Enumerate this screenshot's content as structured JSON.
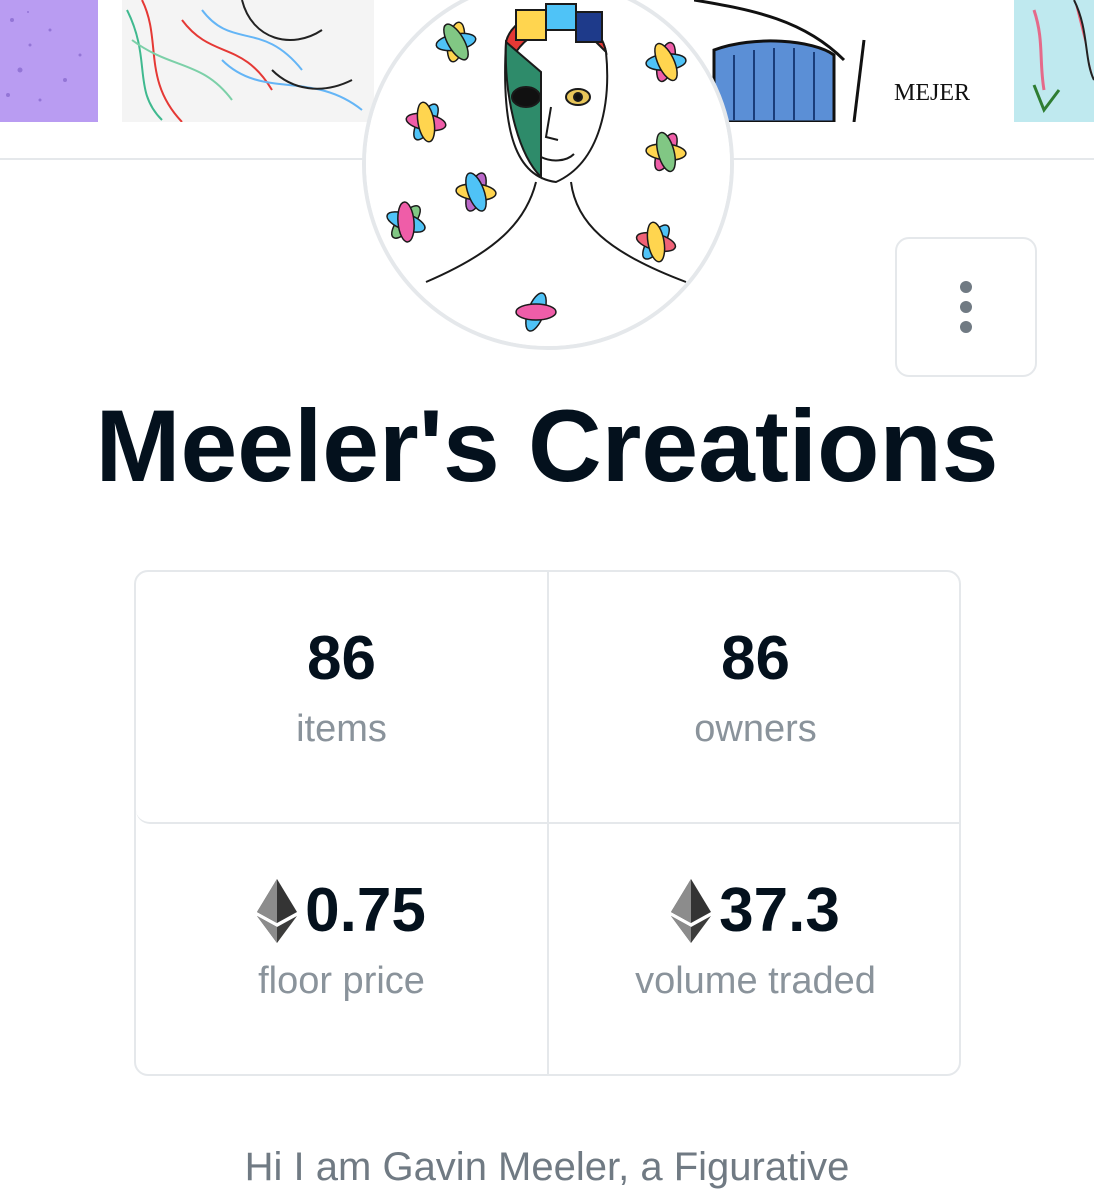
{
  "collection": {
    "title": "Meeler's Creations",
    "banner_signature": "MEJER"
  },
  "stats": {
    "items": {
      "value": "86",
      "label": "items"
    },
    "owners": {
      "value": "86",
      "label": "owners"
    },
    "floor_price": {
      "value": "0.75",
      "label": "floor price"
    },
    "volume_traded": {
      "value": "37.3",
      "label": "volume traded"
    }
  },
  "description": "Hi I am Gavin Meeler, a Figurative",
  "colors": {
    "text_primary": "#04111d",
    "text_secondary": "#8a939b",
    "border": "#e5e8eb"
  }
}
